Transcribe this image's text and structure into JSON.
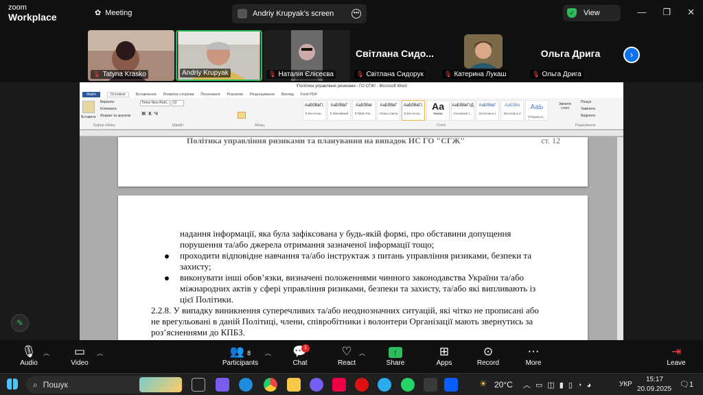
{
  "app": {
    "logo_top": "zoom",
    "logo_bottom": "Workplace",
    "meeting_label": "Meeting"
  },
  "share_chip": {
    "label": "Andriy Krupyak's screen"
  },
  "view_chip": {
    "label": "View"
  },
  "participants": [
    {
      "name": "Tatyna Krasko",
      "muted": true
    },
    {
      "name": "Andriy Krupyak",
      "muted": false,
      "active": true
    },
    {
      "name": "Наталія Єлісеєва",
      "muted": true
    },
    {
      "name": "Світлана Сидорук",
      "muted": true,
      "display_text": "Світлана Сидо..."
    },
    {
      "name": "Катерина Лукаш",
      "muted": true
    },
    {
      "name": "Ольга Дрига",
      "muted": true,
      "display_text": "Ольга Дрига"
    }
  ],
  "word": {
    "title": "!Політика управління ризиками - ГО СГЖ! - Microsoft Word",
    "tabs": [
      "Файл",
      "Основне",
      "Вставлення",
      "Розмітка сторінки",
      "Посилання",
      "Розсилки",
      "Рецензування",
      "Вигляд",
      "Foxit PDF"
    ],
    "clipboard": {
      "paste": "Вставити",
      "cut": "Вирізати",
      "copy": "Копіювати",
      "format": "Формат за зразком",
      "group": "Буфер обміну"
    },
    "font": {
      "name": "Times New Rom...",
      "size": "12",
      "group": "Шрифт"
    },
    "paragraph_group": "Абзац",
    "styles": [
      {
        "preview": "АаБбВвГг,",
        "label": "¶ Без інтер..."
      },
      {
        "preview": "АаБбВвГ",
        "label": "¶ Звичайний"
      },
      {
        "preview": "АаБбВвІ",
        "label": "¶ Table Par..."
      },
      {
        "preview": "АаБбВвГ",
        "label": "Абзац списку"
      },
      {
        "preview": "АаБбВвГг,",
        "label": "¶ Без інтер..."
      },
      {
        "preview": "Аа",
        "label": "Назва"
      },
      {
        "preview": "АаБбВвГгД",
        "label": "Основний т..."
      },
      {
        "preview": "АаБбВвГ",
        "label": "Заголовок 1"
      },
      {
        "preview": "АаБбВв",
        "label": "Заголовок 2"
      },
      {
        "preview": "АаЬ",
        "label": "¶ Підзагол..."
      }
    ],
    "styles_group": "Стилі",
    "change_styles": "Змінити стилі",
    "editing": {
      "find": "Пошук",
      "replace": "Замінити",
      "select": "Виділити",
      "group": "Редагування"
    }
  },
  "document": {
    "header_text": "Політика управління ризиками та планування на випадок НС ГО \"СГЖ\"",
    "header_page": "ст. 12",
    "lines": [
      "надання інформації, яка була зафіксована у будь-якій формі, про обставини допущення",
      "порушення та/або джерела отримання зазначеної інформації тощо;",
      "проходити відповідне навчання та/або інструктаж з питань управління ризиками, безпеки та",
      "захисту;",
      "виконувати інші обов’язки, визначені положеннями чинного законодавства України та/або",
      "міжнародних актів у сфері управління ризиками, безпеки та захисту, та/або які випливають із",
      "цієї Політики.",
      "2.2.8. У випадку виникнення суперечливих та/або неоднозначних ситуацій, які чітко не прописані або",
      "не врегульовані в даній Політиці, члени, співробітники і волонтери Організації мають звернутись за",
      "роз’ясненнями до КПБЗ."
    ]
  },
  "toolbar": {
    "audio": "Audio",
    "video": "Video",
    "participants": "Participants",
    "participants_count": "8",
    "chat": "Chat",
    "chat_badge": "1",
    "react": "React",
    "share": "Share",
    "apps": "Apps",
    "record": "Record",
    "more": "More",
    "leave": "Leave"
  },
  "taskbar": {
    "search": "Пошук",
    "temp": "20°C",
    "lang": "УКР",
    "time": "15:17",
    "date": "20.09.2025",
    "notif": "1"
  }
}
